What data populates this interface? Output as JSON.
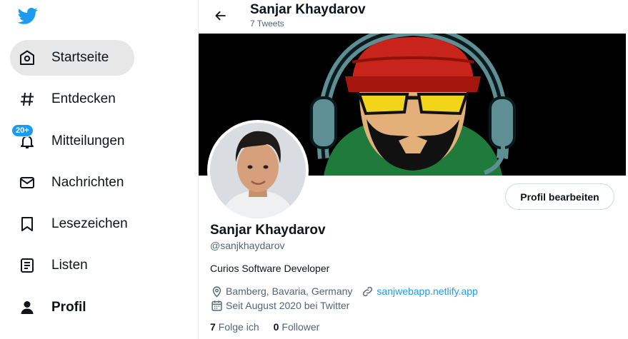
{
  "sidebar": {
    "logo": "twitter-bird-icon",
    "items": [
      {
        "label": "Startseite",
        "icon": "home-icon",
        "active": true
      },
      {
        "label": "Entdecken",
        "icon": "hashtag-icon"
      },
      {
        "label": "Mitteilungen",
        "icon": "bell-icon",
        "badge": "20+"
      },
      {
        "label": "Nachrichten",
        "icon": "mail-icon"
      },
      {
        "label": "Lesezeichen",
        "icon": "bookmark-icon"
      },
      {
        "label": "Listen",
        "icon": "list-icon"
      },
      {
        "label": "Profil",
        "icon": "person-icon"
      }
    ]
  },
  "header": {
    "title": "Sanjar Khaydarov",
    "subtitle": "7 Tweets"
  },
  "profile": {
    "edit_button": "Profil bearbeiten",
    "name": "Sanjar Khaydarov",
    "handle": "@sanjkhaydarov",
    "bio": "Curios Software Developer",
    "location": "Bamberg, Bavaria, Germany",
    "website": "sanjwebapp.netlify.app",
    "joined": "Seit August 2020 bei Twitter",
    "following_count": "7",
    "following_label": "Folge ich",
    "followers_count": "0",
    "followers_label": "Follower"
  },
  "colors": {
    "accent": "#1d9bf0",
    "text": "#0f1419",
    "muted": "#536471"
  }
}
